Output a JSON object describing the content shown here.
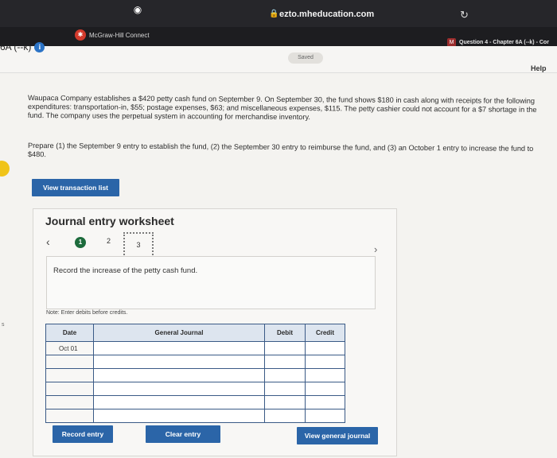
{
  "browser": {
    "url": "ezto.mheducation.com",
    "tabs": [
      {
        "label": "McGraw-Hill Connect"
      },
      {
        "label": "Question 4 - Chapter 6A (--k) - Cor"
      }
    ]
  },
  "header": {
    "breadcrumb": "6A (--k)",
    "saved_label": "Saved",
    "help_label": "Help"
  },
  "problem": {
    "text": "Waupaca Company establishes a $420 petty cash fund on September 9. On September 30, the fund shows $180 in cash along with receipts for the following expenditures: transportation-in, $55; postage expenses, $63; and miscellaneous expenses, $115. The petty cashier could not account for a $7 shortage in the fund. The company uses the perpetual system in accounting for merchandise inventory.",
    "instructions": "Prepare (1) the September 9 entry to establish the fund, (2) the September 30 entry to reimburse the fund, and (3) an October 1 entry to increase the fund to $480."
  },
  "buttons": {
    "view_transaction_list": "View transaction list",
    "record_entry": "Record entry",
    "clear_entry": "Clear entry",
    "view_general_journal": "View general journal"
  },
  "worksheet": {
    "title": "Journal entry worksheet",
    "steps": [
      "1",
      "2",
      "3"
    ],
    "current_step": "3",
    "description": "Record the increase of the petty cash fund.",
    "note": "Note: Enter debits before credits.",
    "columns": [
      "Date",
      "General Journal",
      "Debit",
      "Credit"
    ],
    "first_date": "Oct 01"
  }
}
